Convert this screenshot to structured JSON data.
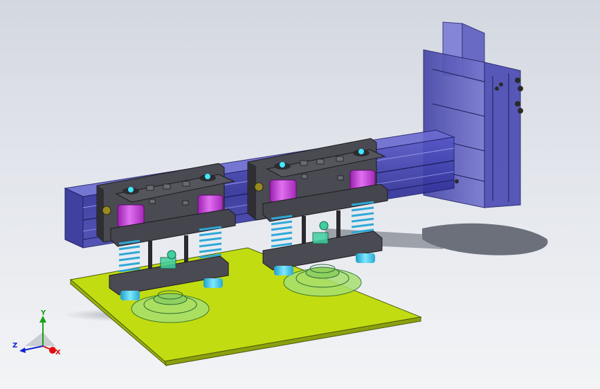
{
  "viewport": {
    "background_top": "#d3d7df",
    "background_bottom": "#f3f4f6"
  },
  "triad": {
    "x_label": "X",
    "y_label": "Y",
    "z_label": "Z",
    "x_color": "#e01010",
    "y_color": "#18a018",
    "z_color": "#1020d0"
  },
  "colors": {
    "rail": "#3a3aa8",
    "column": "#5a5ac0",
    "bracket": "#3f3f48",
    "cylinder": "#c33ad6",
    "spring": "#2ea8d8",
    "foot": "#38c8e8",
    "base_plate": "#c2dc12",
    "suction_cup": "#a8e070",
    "fitting": "#40d0a0"
  },
  "model": {
    "parts": [
      "vertical-column",
      "horizontal-rail",
      "gripper-unit-left",
      "gripper-unit-right",
      "base-plate",
      "suction-cup-left",
      "suction-cup-right"
    ]
  }
}
